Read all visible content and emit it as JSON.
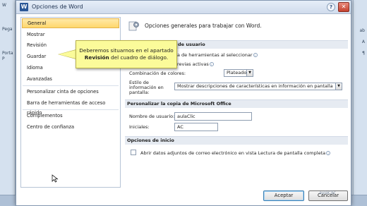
{
  "window": {
    "title": "Opciones de Word",
    "help_icon": "help-icon",
    "close_icon": "close-icon"
  },
  "background_app": {
    "left_fragments": [
      "W",
      "Pega",
      "Porta",
      "P"
    ],
    "right_fragments": [
      "ab",
      "A",
      "¶"
    ]
  },
  "nav": {
    "items": [
      {
        "label": "General",
        "selected": true
      },
      {
        "label": "Mostrar",
        "selected": false
      },
      {
        "label": "Revisión",
        "selected": false
      },
      {
        "label": "Guardar",
        "selected": false
      },
      {
        "label": "Idioma",
        "selected": false
      },
      {
        "label": "Avanzadas",
        "selected": false
      },
      {
        "label": "Personalizar cinta de opciones",
        "selected": false
      },
      {
        "label": "Barra de herramientas de acceso rápido",
        "selected": false
      },
      {
        "label": "Complementos",
        "selected": false
      },
      {
        "label": "Centro de confianza",
        "selected": false
      }
    ]
  },
  "content": {
    "heading": "Opciones generales para trabajar con Word.",
    "sections": {
      "ui_options_fragment": "de usuario",
      "personalize": "Personalizar la copia de Microsoft Office",
      "startup": "Opciones de inicio"
    },
    "ui_options": {
      "toolbar_fragment": "a de herramientas al seleccionar",
      "previews_fragment": "revias activas",
      "color_scheme_label": "Combinación de colores:",
      "color_scheme_value": "Plateado",
      "tooltip_style_label_1": "Estilo de",
      "tooltip_style_label_2": "información en",
      "tooltip_style_label_3": "pantalla:",
      "tooltip_style_value": "Mostrar descripciones de características en información en pantalla"
    },
    "personalize_fields": {
      "username_label": "Nombre de usuario:",
      "username_value": "aulaClic",
      "initials_label": "Iniciales:",
      "initials_value": "AC"
    },
    "startup_options": {
      "open_attachments_label": "Abrir datos adjuntos de correo electrónico en vista Lectura de pantalla completa"
    }
  },
  "callout": {
    "line1": "Deberemos situarnos en el apartado",
    "line2_bold": "Revisión",
    "line2_rest": " del cuadro de diálogo."
  },
  "buttons": {
    "accept": "Aceptar",
    "cancel": "Cancelar"
  },
  "watermark": "aulaClic",
  "colors": {
    "selected_nav_bg": "#ffd76c",
    "callout_bg": "#fbfb9a",
    "close_button": "#c4422f"
  }
}
